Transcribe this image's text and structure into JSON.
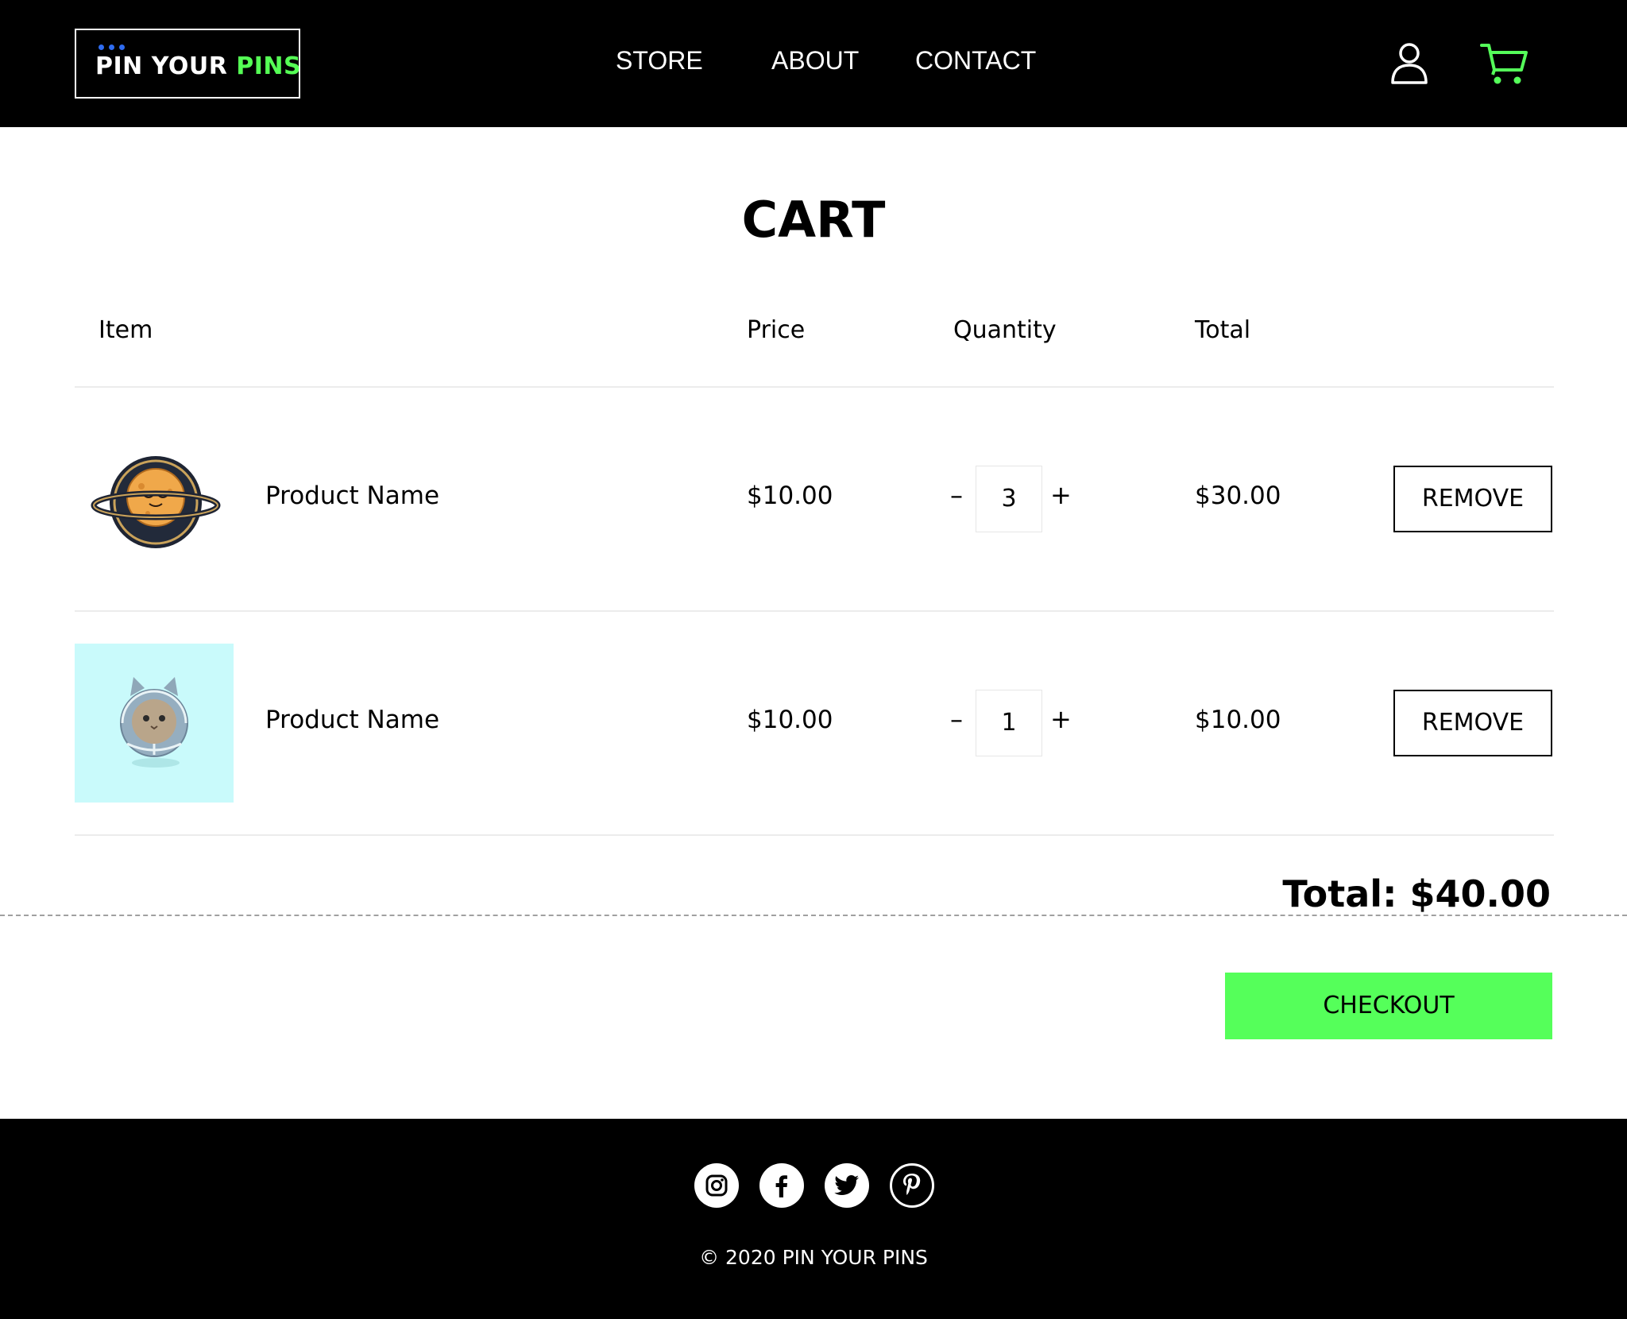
{
  "header": {
    "logo": {
      "text_main": "PIN YOUR ",
      "text_accent": "PINS"
    },
    "nav": [
      {
        "label": "STORE"
      },
      {
        "label": "ABOUT"
      },
      {
        "label": "CONTACT"
      }
    ],
    "icons": {
      "user": "user-icon",
      "cart": "cart-icon"
    }
  },
  "main": {
    "title": "CART",
    "columns": {
      "item": "Item",
      "price": "Price",
      "quantity": "Quantity",
      "total": "Total"
    },
    "items": [
      {
        "name": "Product Name",
        "price": "$10.00",
        "quantity": "3",
        "total": "$30.00",
        "remove_label": "REMOVE",
        "minus": "–",
        "plus": "+"
      },
      {
        "name": "Product Name",
        "price": "$10.00",
        "quantity": "1",
        "total": "$10.00",
        "remove_label": "REMOVE",
        "minus": "–",
        "plus": "+"
      }
    ],
    "grand_total": "Total: $40.00",
    "checkout_label": "CHECKOUT"
  },
  "footer": {
    "social": [
      "instagram-icon",
      "facebook-icon",
      "twitter-icon",
      "pinterest-icon"
    ],
    "copyright": "© 2020 PIN YOUR PINS"
  },
  "colors": {
    "accent": "#55ff5a",
    "header_bg": "#000000",
    "logo_dots": "#2f6cf0",
    "thumb_bg": "#c9fafb"
  }
}
